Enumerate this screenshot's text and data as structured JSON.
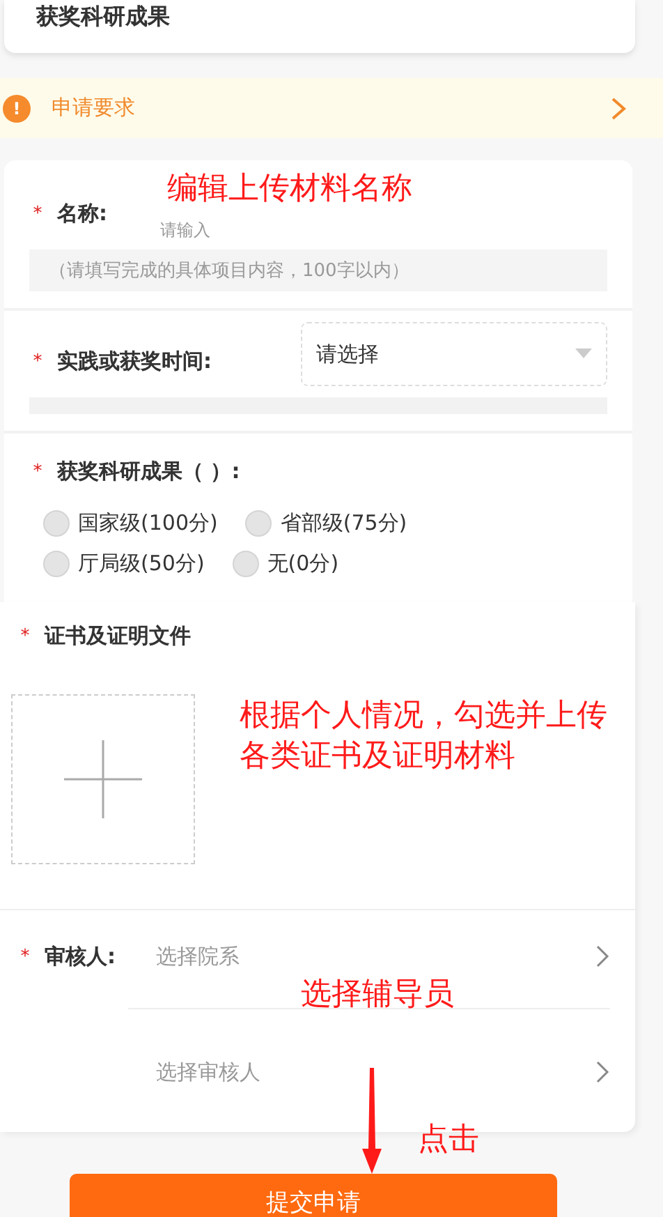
{
  "header": {
    "title": "获奖科研成果"
  },
  "notice": {
    "text": "申请要求",
    "icon_text": "!"
  },
  "name_field": {
    "label": "名称:",
    "required_mark": "*",
    "placeholder": "请输入",
    "hint": "（请填写完成的具体项目内容，100字以内）"
  },
  "time_field": {
    "label": "实践或获奖时间:",
    "required_mark": "*",
    "value": "请选择"
  },
  "level_field": {
    "label": "获奖科研成果（      ）:",
    "required_mark": "*",
    "options": [
      {
        "label": "国家级(100分)",
        "selected": false
      },
      {
        "label": "省部级(75分)",
        "selected": false
      },
      {
        "label": "厅局级(50分)",
        "selected": false
      },
      {
        "label": "无(0分)",
        "selected": false
      }
    ]
  },
  "upload_field": {
    "label": "证书及证明文件",
    "required_mark": "*"
  },
  "reviewer_field": {
    "label": "审核人:",
    "required_mark": "*",
    "pickers": [
      "选择院系",
      "选择审核人"
    ]
  },
  "submit_button": "提交申请",
  "annotations": [
    {
      "kind": "text",
      "text": "编辑上传材料名称"
    },
    {
      "kind": "text",
      "text": "根据个人情况，勾选并上传各类证书及证明材料"
    },
    {
      "kind": "text",
      "text": "选择辅导员"
    },
    {
      "kind": "arrow_text",
      "text": "点击"
    }
  ]
}
